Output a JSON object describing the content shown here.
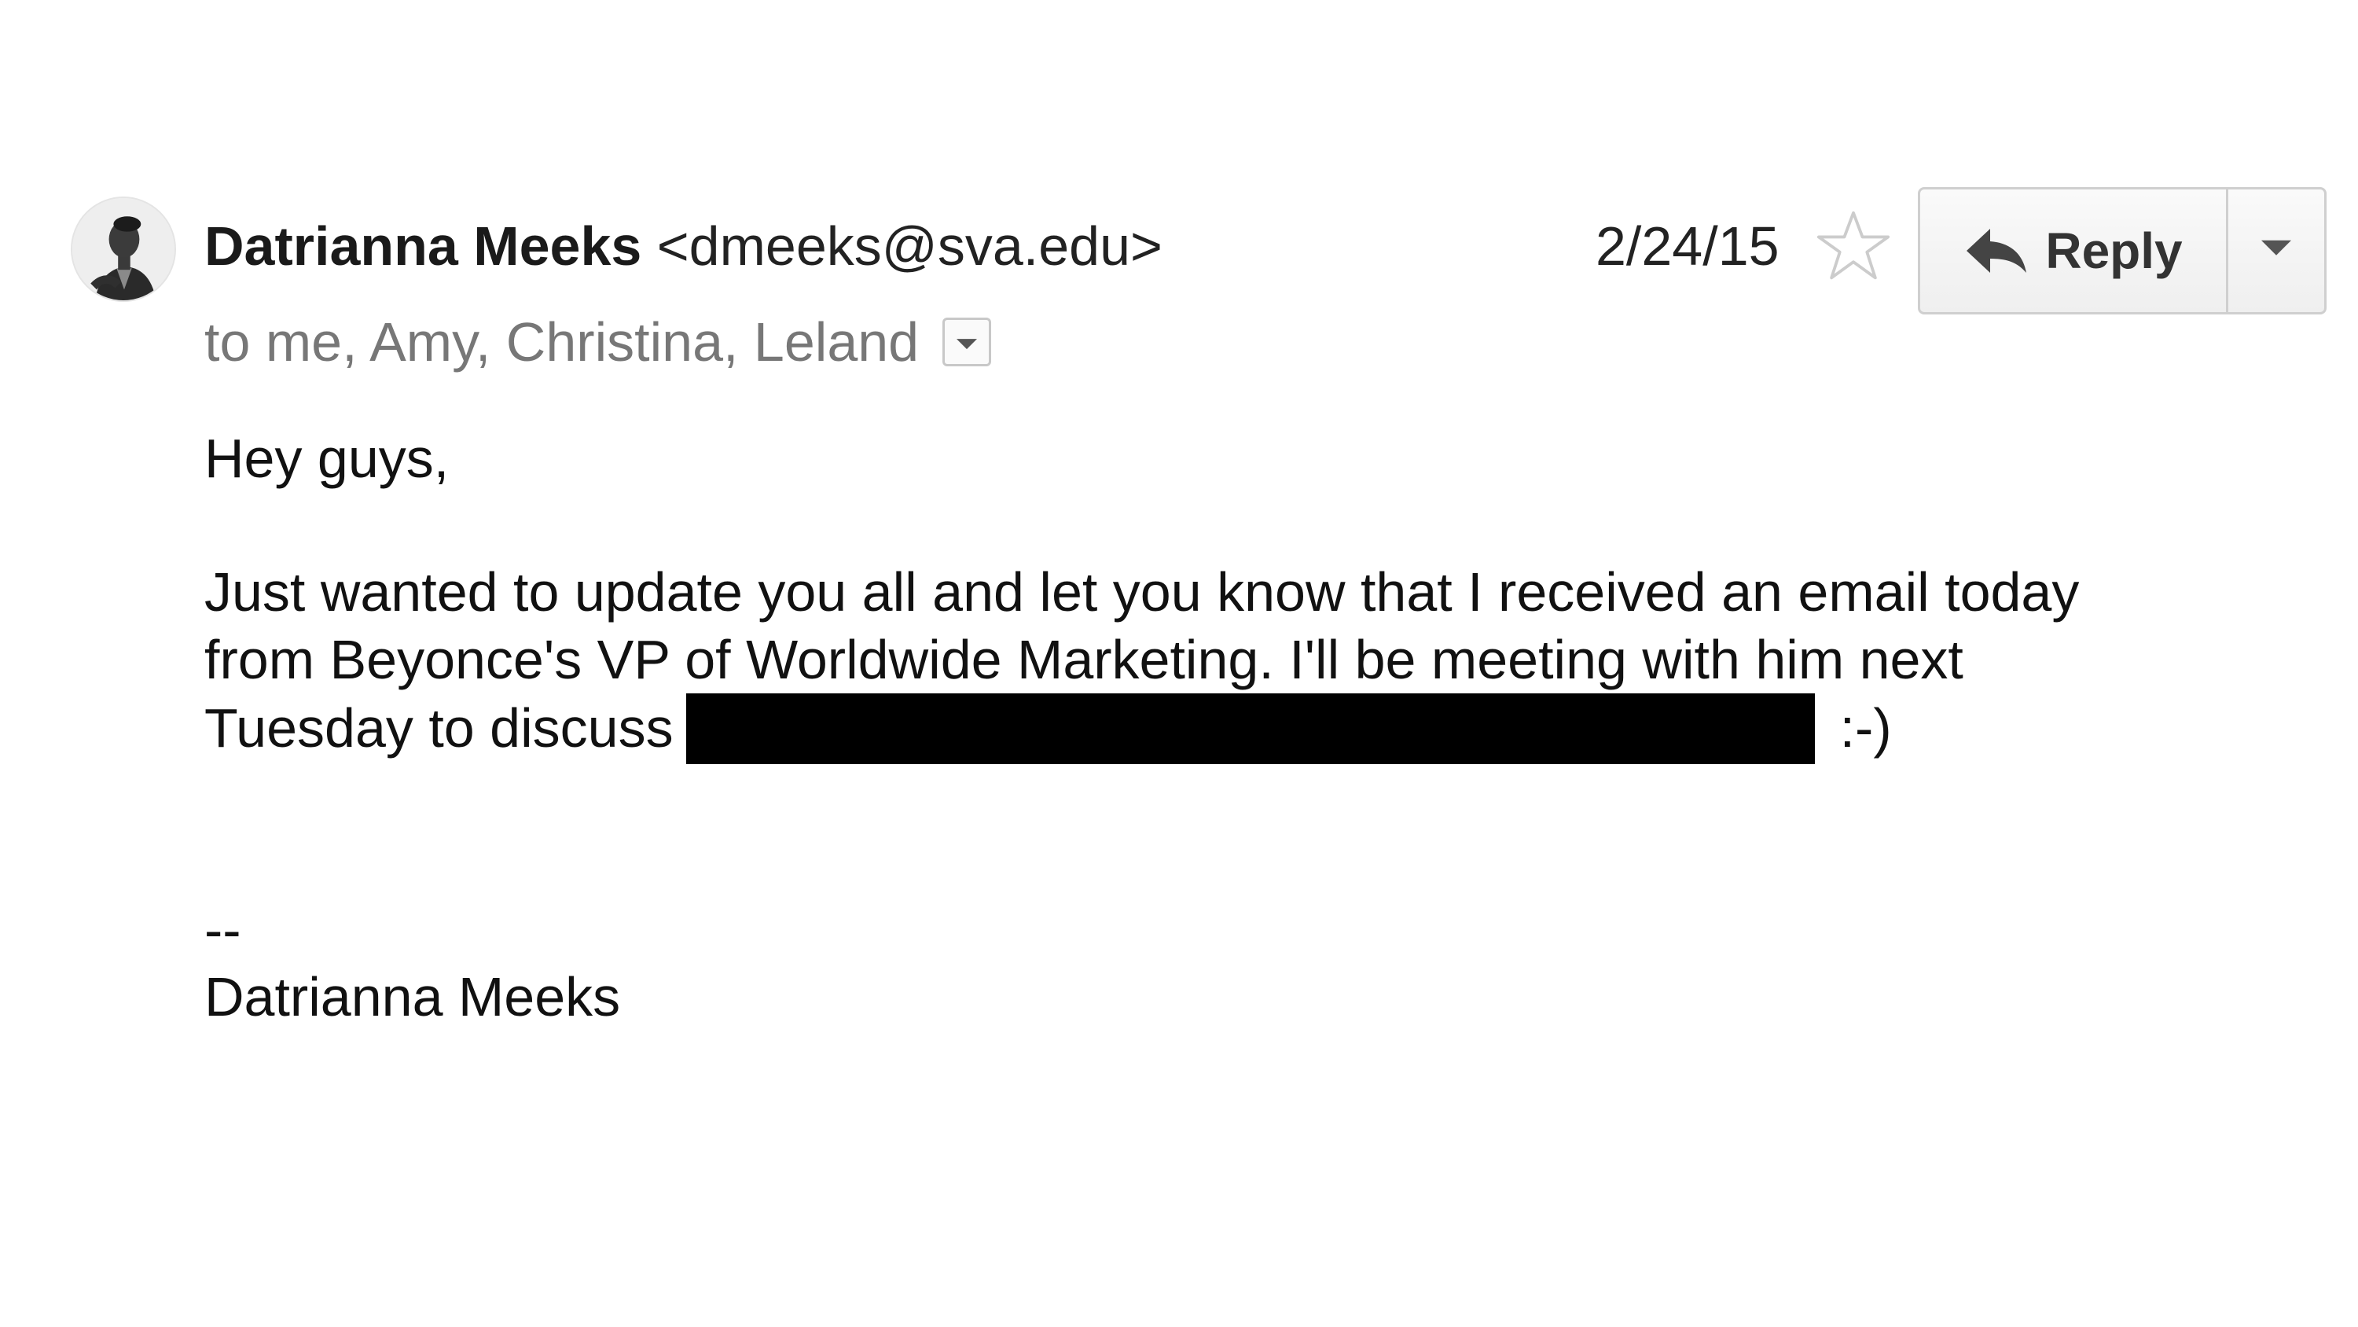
{
  "message": {
    "sender": {
      "name": "Datrianna Meeks",
      "email": "<dmeeks@sva.edu>",
      "avatar_icon": "person-photo-avatar"
    },
    "recipients": "to me, Amy, Christina, Leland",
    "date": "2/24/15",
    "actions": {
      "star_icon": "star-outline-icon",
      "reply_label": "Reply",
      "reply_icon": "reply-arrow-icon",
      "more_icon": "chevron-down-icon"
    },
    "body": {
      "greeting": "Hey guys,",
      "line1": "Just wanted to update you all and let you know that I received an email today",
      "line2": "from Beyonce's VP of Worldwide Marketing. I'll be meeting with him next",
      "line3_before": "Tuesday to discuss",
      "line3_after": ":-)",
      "signature_separator": "--",
      "signature_name": "Datrianna Meeks"
    }
  }
}
